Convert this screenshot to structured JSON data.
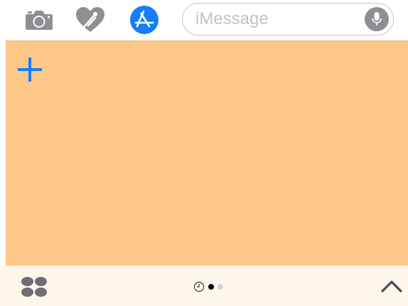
{
  "toolbar": {
    "icons": [
      "camera-icon",
      "digital-touch-heart-icon",
      "app-store-icon"
    ],
    "app_store_active": true,
    "accent_color": "#147efb",
    "icon_color": "#8e8e93"
  },
  "message": {
    "placeholder": "iMessage",
    "value": ""
  },
  "drawer": {
    "background_color": "#fdc887",
    "add_icon": "plus-icon"
  },
  "bottom_bar": {
    "background_color": "#fdf6ea",
    "pager": {
      "pages": 2,
      "current_page": 1,
      "recents_icon": "clock-icon"
    },
    "expand_icon": "chevron-up-icon",
    "apps_icon": "app-drawer-grid-icon"
  }
}
